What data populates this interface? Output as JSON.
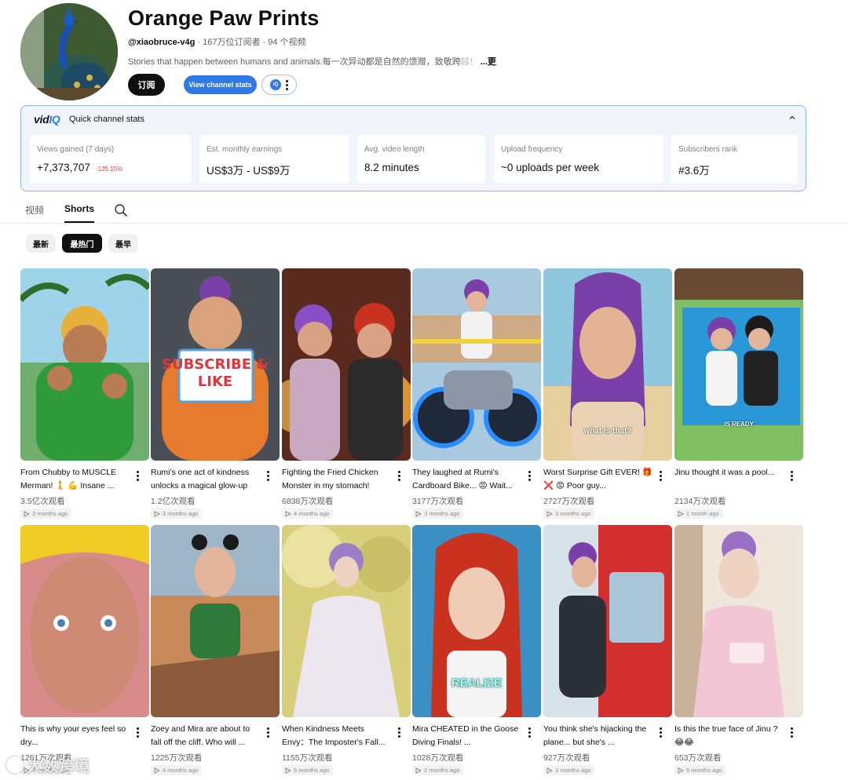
{
  "channel": {
    "title": "Orange Paw Prints",
    "handle": "@xiaobruce-v4g",
    "subscribers": "167万位订阅者",
    "videos": "94 个视频",
    "separator": " · ",
    "description": "Stories that happen between humans and animals.每一次异动都是自然的馈赠，致敬跨",
    "description_fade": "越！",
    "more_label": "...更多",
    "subscribe_label": "订阅",
    "stats_label": "View channel stats",
    "vidiq_badge": "iQ"
  },
  "vidiq": {
    "logo_vid": "vid",
    "logo_iq": "IQ",
    "heading": "Quick channel stats",
    "collapse_icon": "chevron-up-icon",
    "stats": [
      {
        "label": "Views gained (7 days)",
        "value": "+7,373,707",
        "badge": "-125.15%"
      },
      {
        "label": "Est. monthly earnings",
        "value": "US$3万 - US$9万"
      },
      {
        "label": "Avg. video length",
        "value": "8.2 minutes"
      },
      {
        "label": "Upload frequency",
        "value": "~0 uploads per week"
      },
      {
        "label": "Subscribers rank",
        "value": "#3.6万"
      }
    ]
  },
  "tabs": [
    {
      "label": "视频",
      "active": false
    },
    {
      "label": "Shorts",
      "active": true
    }
  ],
  "filters": [
    {
      "label": "最新",
      "active": false
    },
    {
      "label": "最热门",
      "active": true
    },
    {
      "label": "最早",
      "active": false
    }
  ],
  "shorts": [
    {
      "title": "From Chubby to MUSCLE Merman! 🧜 💪 Insane ...",
      "views": "3.5亿次观看",
      "age": "3 months ago"
    },
    {
      "title": "Rumi's one act of kindness unlocks a magical glow-up",
      "views": "1.2亿次观看",
      "age": "3 months ago",
      "overlay": "SUBSCRIBE & LIKE"
    },
    {
      "title": "Fighting the Fried Chicken Monster in my stomach!",
      "views": "6838万次观看",
      "age": "4 months ago"
    },
    {
      "title": "They laughed at Rumi's Cardboard Bike... 😡 Wait...",
      "views": "3177万次观看",
      "age": "3 months ago"
    },
    {
      "title": "Worst Surprise Gift EVER! 🎁 ❌ 😡 Poor guy...",
      "views": "2727万次观看",
      "age": "3 months ago",
      "overlay": "what is that?"
    },
    {
      "title": "Jinu thought it was a pool...",
      "views": "2134万次观看",
      "age": "1 month ago",
      "overlay": "IS READY"
    },
    {
      "title": "This is why your eyes feel so dry...",
      "views": "1261万次观看",
      "age": "3 months ago"
    },
    {
      "title": "Zoey and Mira are about to fall off the cliff. Who will ...",
      "views": "1225万次观看",
      "age": "4 months ago"
    },
    {
      "title": "When Kindness Meets Envy：The Imposter's Fall...",
      "views": "1155万次观看",
      "age": "5 months ago"
    },
    {
      "title": "Mira CHEATED in the Goose Diving Finals! ...",
      "views": "1028万次观看",
      "age": "2 months ago",
      "overlay": "REALIZE"
    },
    {
      "title": "You think she's hijacking the plane... but she's ...",
      "views": "927万次观看",
      "age": "3 months ago"
    },
    {
      "title": "Is this the true face of Jinu ?😂😂",
      "views": "653万次观看",
      "age": "5 months ago"
    }
  ],
  "watermark": "大数跨境",
  "colors": {
    "accent": "#2f7ae5",
    "negative": "#e0394a",
    "panel_border": "#8fb4e8",
    "panel_bg": "#f1f4fb"
  }
}
